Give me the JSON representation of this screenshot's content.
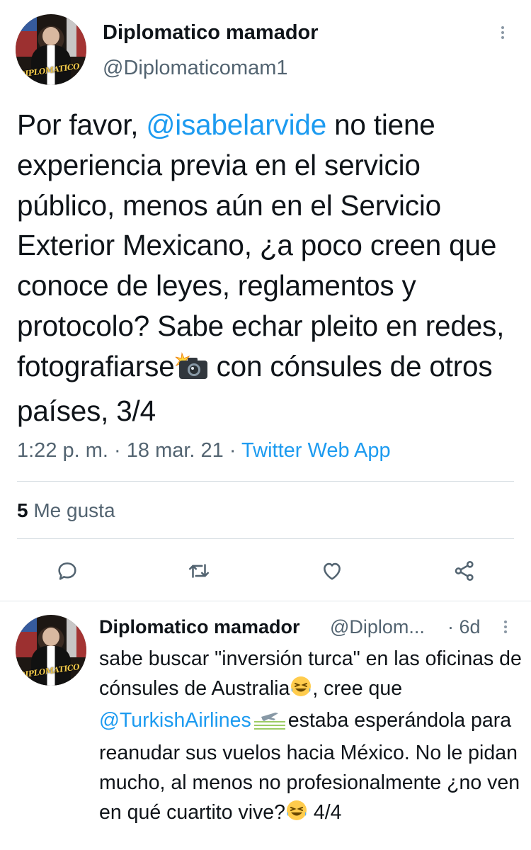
{
  "tweet": {
    "author_name": "Diplomatico mamador",
    "author_handle": "@Diplomaticomam1",
    "avatar_watermark": "DIPLOMATICO MAMADOR",
    "text_1": "Por favor, ",
    "mention": "@isabelarvide",
    "text_2": " no tiene experiencia previa en el servicio público, menos aún en el Servicio Exterior Mexicano, ¿a poco creen que conoce de leyes, reglamentos y protocolo? Sabe echar pleito en redes, fotografiarse",
    "text_3": " con cónsules de otros países, 3/4",
    "time": "1:22 p. m.",
    "separator": " · ",
    "date": "18 mar. 21",
    "source": "Twitter Web App",
    "likes_count": "5",
    "likes_label": " Me gusta"
  },
  "actions": [
    "reply-icon",
    "retweet-icon",
    "like-icon",
    "share-icon"
  ],
  "reply": {
    "author_name": "Diplomatico mamador",
    "author_handle": "@Diplom...",
    "time": "· 6d",
    "text_1": "sabe buscar \"inversión turca\" en las oficinas de cónsules de Australia",
    "text_2": ", cree que ",
    "mention": "@TurkishAirlines",
    "text_3": "estaba esperándola para reanudar sus vuelos hacia México. No le pidan mucho, al menos no profesionalmente ¿no ven en qué cuartito vive?",
    "text_4": " 4/4"
  },
  "colors": {
    "link": "#1d9bf0",
    "secondary": "#536471",
    "text": "#0f1419"
  }
}
